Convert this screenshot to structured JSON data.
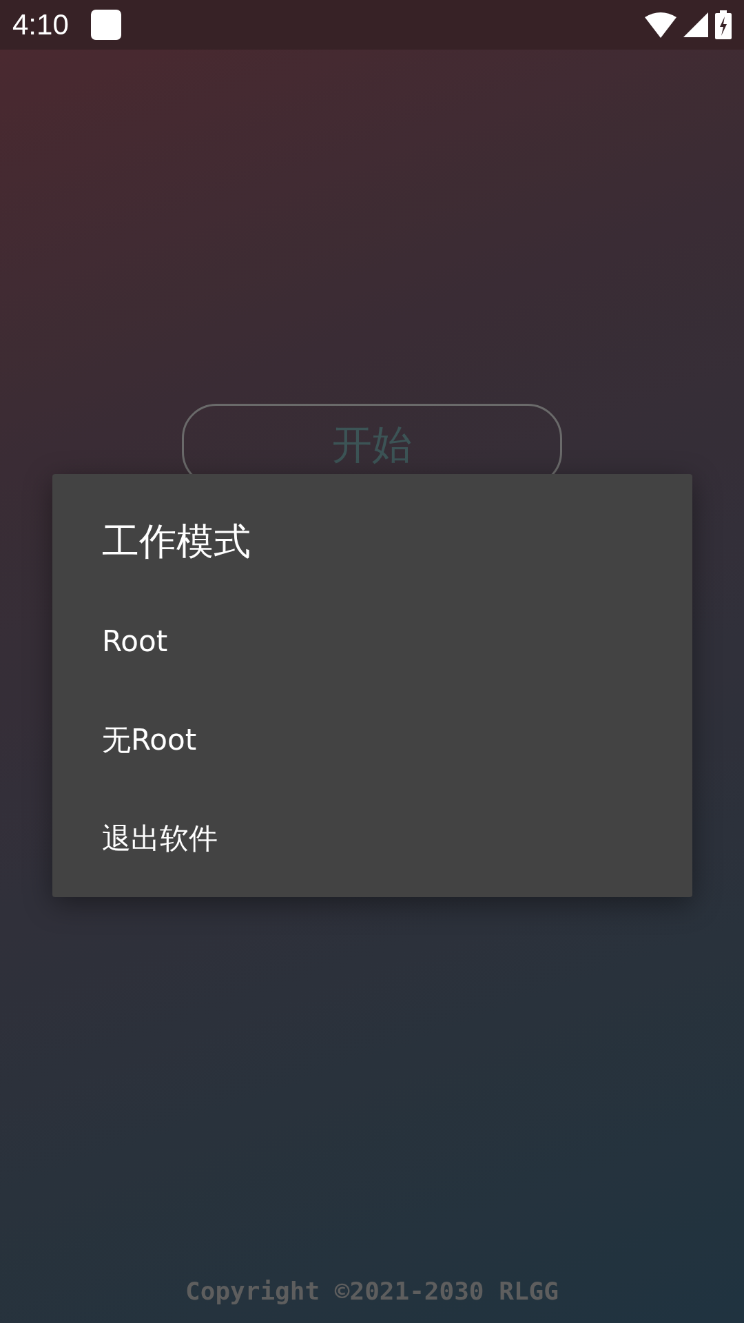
{
  "status_bar": {
    "time": "4:10"
  },
  "start_button": {
    "label": "开始"
  },
  "dialog": {
    "title": "工作模式",
    "items": [
      {
        "label": "Root"
      },
      {
        "label": "无Root"
      },
      {
        "label": "退出软件"
      }
    ]
  },
  "footer": "Copyright ©2021-2030 RLGG"
}
